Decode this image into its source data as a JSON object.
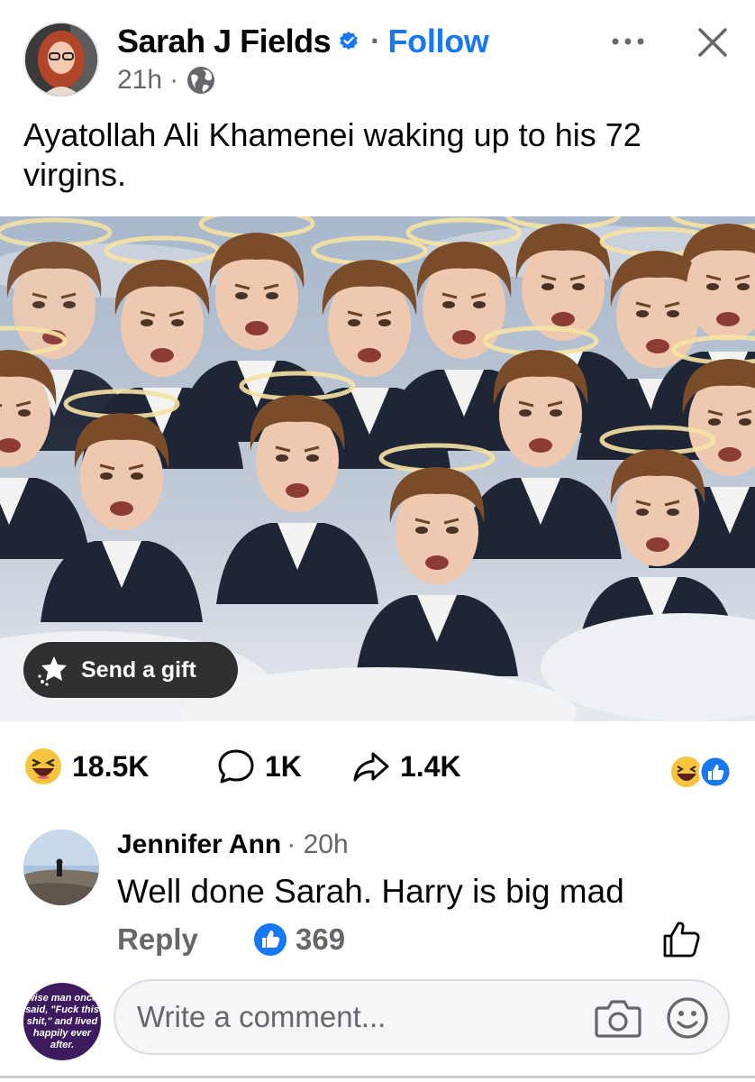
{
  "post": {
    "author": "Sarah J Fields",
    "follow_label": "Follow",
    "time": "21h",
    "meta_separator": "·",
    "text": "Ayatollah Ali Khamenei waking up to his 72 virgins.",
    "send_gift_label": "Send a gift"
  },
  "stats": {
    "reactions": "18.5K",
    "comments": "1K",
    "shares": "1.4K"
  },
  "comment": {
    "author": "Jennifer Ann",
    "time": "· 20h",
    "text": "Well done Sarah. Harry is big mad",
    "reply_label": "Reply",
    "like_count": "369"
  },
  "composer": {
    "placeholder": "Write a comment...",
    "avatar_text": "wise man once said, \"Fuck this shit,\" and lived happily ever after."
  },
  "colors": {
    "accent": "#1877f2",
    "secondary_text": "#65676b",
    "haha_yellow": "#f7c53d"
  },
  "icons": [
    "verified-badge-icon",
    "globe-icon",
    "more-icon",
    "close-icon",
    "gift-icon",
    "haha-icon",
    "comment-icon",
    "share-icon",
    "like-icon",
    "camera-icon",
    "emoji-icon"
  ]
}
